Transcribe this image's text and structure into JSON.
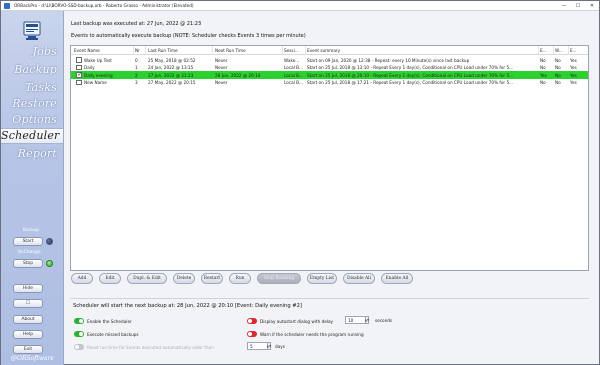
{
  "window": {
    "title": "ORBackPro - d:\\Ll\\BORVO-SSD-backup.orb - Roberto Grasso - Administrator (Elevated)",
    "controls": [
      "—",
      "☐",
      "✕"
    ]
  },
  "sidebar": {
    "nav": [
      {
        "label": "Jobs",
        "active": false
      },
      {
        "label": "Backup",
        "active": false
      },
      {
        "label": "Tasks",
        "active": false
      },
      {
        "label": "Restore",
        "active": false
      },
      {
        "label": "Options",
        "active": false
      },
      {
        "label": "Scheduler",
        "active": true
      },
      {
        "label": "Report",
        "active": false
      }
    ],
    "backup_label": "Backup",
    "start_label": "Start",
    "onchange_label": "OnChange",
    "stop_label": "Stop",
    "buttons": {
      "hide": "Hide",
      "minimize": "☐",
      "about": "About",
      "help": "Help",
      "exit": "Exit"
    },
    "footer": "@ORSoftware"
  },
  "main": {
    "last_backup": "Last backup was executed at:    27 Jun, 2022 @ 21:23",
    "events_hint": "Events to automatically execute backup (NOTE: Scheduler checks Events 3 times per minute)",
    "table": {
      "headers": [
        "Event Name",
        "Nr",
        "Last Run Time",
        "Next Run Time",
        "Sessi...",
        "Event summary",
        "E...",
        "W...",
        "E..."
      ],
      "rows": [
        {
          "checked": false,
          "selected": false,
          "cells": [
            "Wake Up Test",
            "0",
            "25 May, 2018 @ 02:52",
            "Never",
            "Wake...",
            "Start on 09 Jan, 2020 @ 12:38 - Repeat: every 10 Minute(s) since last backup",
            "No",
            "No",
            "Yes"
          ]
        },
        {
          "checked": false,
          "selected": false,
          "cells": [
            "Daily",
            "1",
            "24 Jan, 2022 @ 13:15",
            "Never",
            "Local B...",
            "Start on 25 Jul, 2018 @ 13:10 - Repeat Every 1 day(s), Conditional on CPU Load under 70% for 5...",
            "No",
            "No",
            "Yes"
          ]
        },
        {
          "checked": true,
          "selected": true,
          "cells": [
            "Daily evening",
            "2",
            "27 Jun, 2022 @ 21:23",
            "28 Jun, 2022 @ 20:10",
            "Local B...",
            "Start on 25 Jul, 2018 @ 20:10 - Repeat Every 1 day(s), Conditional on CPU Load under 70% for 5...",
            "Yes",
            "No",
            "Yes"
          ]
        },
        {
          "checked": false,
          "selected": false,
          "cells": [
            "New Name",
            "3",
            "27 May, 2022 @ 20:15",
            "Never",
            "Local B...",
            "Start on 25 Jul, 2018 @ 17:21 - Repeat Every 1 day(s), Conditional on CPU Load under 70% for 5...",
            "No",
            "No",
            "Yes"
          ]
        }
      ]
    },
    "buttons": [
      {
        "label": "Add",
        "enabled": true
      },
      {
        "label": "Edit",
        "enabled": true
      },
      {
        "label": "Dupl. & Edit",
        "enabled": true
      },
      {
        "label": "Delete",
        "enabled": true
      },
      {
        "label": "Restart",
        "enabled": true
      },
      {
        "label": "Run",
        "enabled": true
      },
      {
        "label": "Stop Running",
        "enabled": false
      },
      {
        "label": "Empty List",
        "enabled": true
      },
      {
        "label": "Disable All",
        "enabled": true
      },
      {
        "label": "Enable All",
        "enabled": true
      }
    ],
    "next_backup": "Scheduler will start the next backup at:     28 Jun, 2022 @ 20:10  [Event: Daily evening #2]",
    "options": {
      "enable_scheduler": {
        "label": "Enable the Scheduler",
        "on": true
      },
      "execute_missed": {
        "label": "Execute missed backups",
        "on": true
      },
      "display_dialog": {
        "label": "Display autostart dialog with delay",
        "on": false,
        "value": "10",
        "unit": "seconds"
      },
      "warn_if": {
        "label": "Warn if the scheduler needs the program running",
        "on": false
      },
      "reset_counter": {
        "label": "Reset run time for Events executed automatically older than",
        "value": "5",
        "unit": "days"
      }
    },
    "colors": {
      "selected_row": "#2ad12f",
      "toggle_on": "#27b32e",
      "toggle_off": "#d92b2b"
    }
  }
}
